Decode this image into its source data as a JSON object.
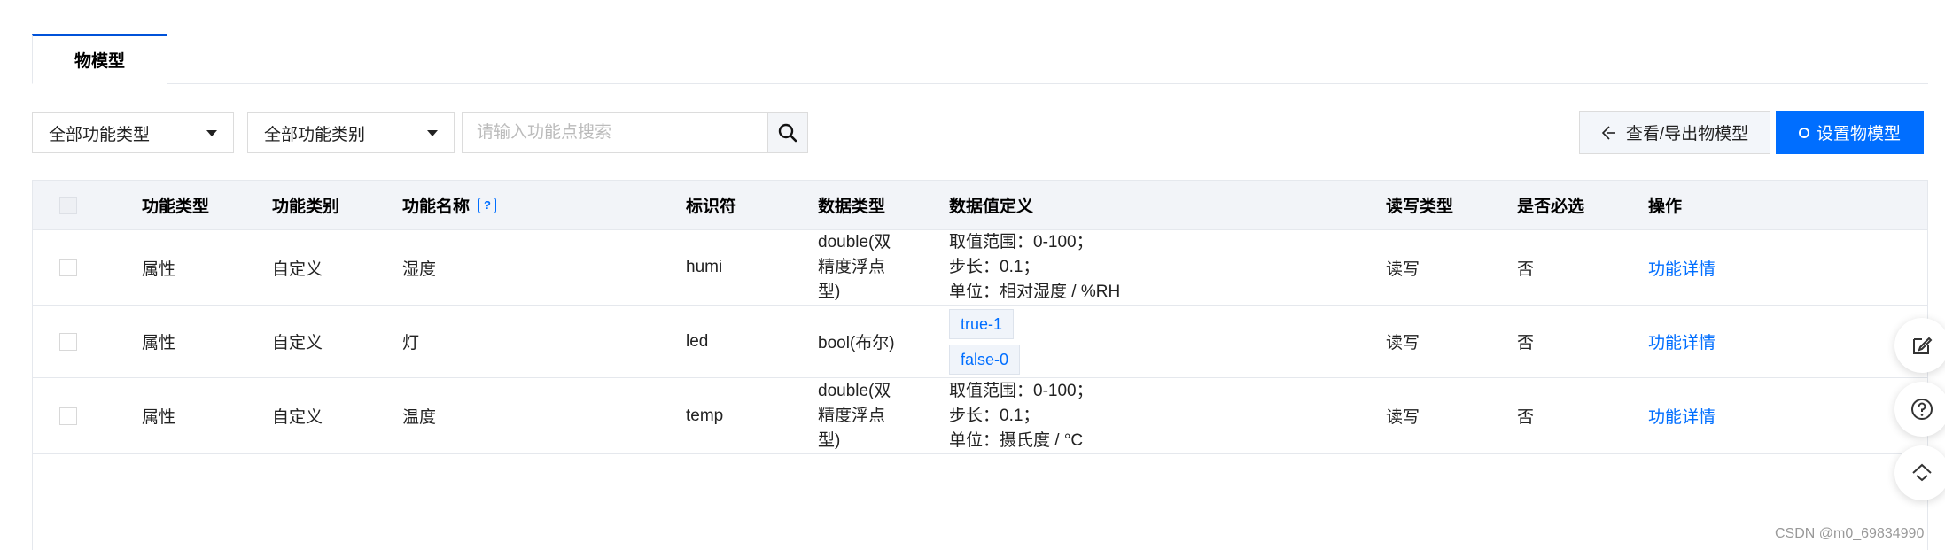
{
  "tabs": [
    {
      "label": "物模型",
      "active": true
    }
  ],
  "filters": {
    "type_select": "全部功能类型",
    "category_select": "全部功能类别",
    "search_placeholder": "请输入功能点搜索"
  },
  "actions": {
    "view_export": "查看/导出物模型",
    "configure": "设置物模型"
  },
  "table": {
    "headers": {
      "type": "功能类型",
      "category": "功能类别",
      "name": "功能名称",
      "identifier": "标识符",
      "data_type": "数据类型",
      "data_def": "数据值定义",
      "rw": "读写类型",
      "required": "是否必选",
      "action": "操作"
    },
    "rows": [
      {
        "type": "属性",
        "category": "自定义",
        "name": "湿度",
        "identifier": "humi",
        "data_type": [
          "double(双",
          "精度浮点",
          "型)"
        ],
        "data_def": [
          "取值范围：0-100；",
          "步长：0.1；",
          "单位：相对湿度 / %RH"
        ],
        "rw": "读写",
        "required": "否",
        "action": "功能详情"
      },
      {
        "type": "属性",
        "category": "自定义",
        "name": "灯",
        "identifier": "led",
        "data_type": [
          "bool(布尔)"
        ],
        "tags": [
          "true-1",
          "false-0"
        ],
        "rw": "读写",
        "required": "否",
        "action": "功能详情"
      },
      {
        "type": "属性",
        "category": "自定义",
        "name": "温度",
        "identifier": "temp",
        "data_type": [
          "double(双",
          "精度浮点",
          "型)"
        ],
        "data_def": [
          "取值范围：0-100；",
          "步长：0.1；",
          "单位：摄氏度 / °C"
        ],
        "rw": "读写",
        "required": "否",
        "action": "功能详情"
      }
    ]
  },
  "watermark": "CSDN @m0_69834990",
  "colors": {
    "primary": "#006eff",
    "tab_accent": "#0052d9",
    "header_bg": "#f2f4f8"
  },
  "icons": [
    "search-icon",
    "export-icon",
    "ring-icon",
    "help-icon",
    "edit-icon",
    "question-icon",
    "collapse-icon"
  ]
}
